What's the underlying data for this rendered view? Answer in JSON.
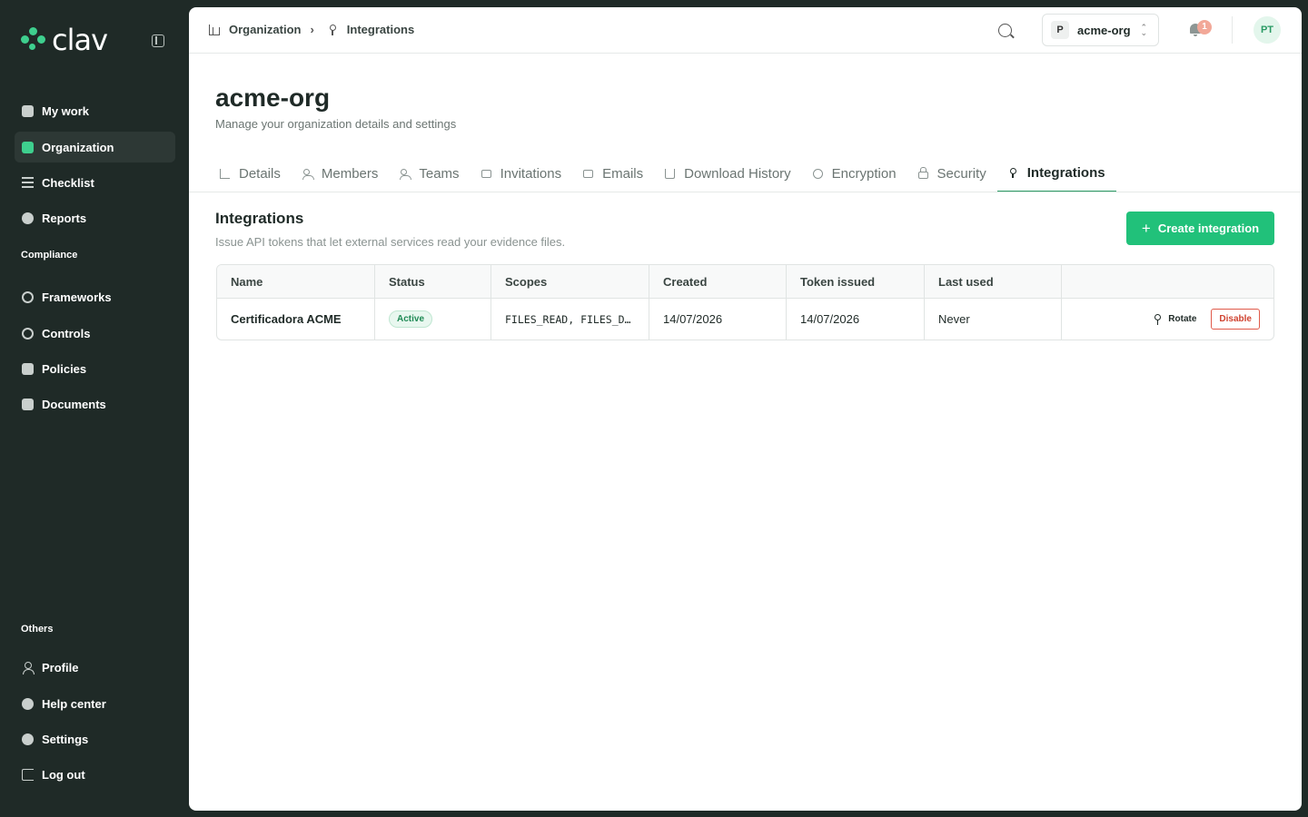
{
  "sidebar": {
    "logo_text": "clav",
    "items": [
      {
        "label": "My work",
        "icon": "folder-icon"
      },
      {
        "label": "Organization",
        "icon": "building-icon",
        "active": true
      },
      {
        "label": "Checklist",
        "icon": "list-icon"
      },
      {
        "label": "Reports",
        "icon": "chart-icon"
      }
    ],
    "compliance_label": "Compliance",
    "compliance_items": [
      {
        "label": "Frameworks",
        "icon": "framework-icon"
      },
      {
        "label": "Controls",
        "icon": "controls-icon"
      },
      {
        "label": "Policies",
        "icon": "policy-icon"
      },
      {
        "label": "Documents",
        "icon": "document-icon"
      }
    ],
    "others_label": "Others",
    "other_items": [
      {
        "label": "Profile",
        "icon": "user-icon"
      },
      {
        "label": "Help center",
        "icon": "help-icon"
      },
      {
        "label": "Settings",
        "icon": "gear-icon"
      },
      {
        "label": "Log out",
        "icon": "logout-icon"
      }
    ]
  },
  "topbar": {
    "breadcrumb": [
      "Organization",
      "Integrations"
    ],
    "org_initial": "P",
    "org_name": "acme-org",
    "notification_count": "1",
    "user_initials": "PT"
  },
  "page": {
    "title": "acme-org",
    "subtitle": "Manage your organization details and settings"
  },
  "tabs": [
    {
      "label": "Details",
      "icon": "chart-icon"
    },
    {
      "label": "Members",
      "icon": "people-icon"
    },
    {
      "label": "Teams",
      "icon": "people-icon"
    },
    {
      "label": "Invitations",
      "icon": "mail-icon"
    },
    {
      "label": "Emails",
      "icon": "mail-icon"
    },
    {
      "label": "Download History",
      "icon": "download-icon"
    },
    {
      "label": "Encryption",
      "icon": "shield-icon"
    },
    {
      "label": "Security",
      "icon": "lock-icon"
    },
    {
      "label": "Integrations",
      "icon": "key-icon",
      "active": true
    }
  ],
  "integrations": {
    "title": "Integrations",
    "subtitle": "Issue API tokens that let external services read your evidence files.",
    "create_label": "Create integration",
    "columns": [
      "Name",
      "Status",
      "Scopes",
      "Created",
      "Token issued",
      "Last used",
      ""
    ],
    "rows": [
      {
        "name": "Certificadora ACME",
        "status": "Active",
        "scopes": "FILES_READ, FILES_D…",
        "created": "14/07/2026",
        "token_issued": "14/07/2026",
        "last_used": "Never",
        "rotate_label": "Rotate",
        "disable_label": "Disable"
      }
    ]
  },
  "colors": {
    "accent": "#21c17a",
    "sidebar_bg": "#1f2a27",
    "danger": "#d0422f"
  }
}
